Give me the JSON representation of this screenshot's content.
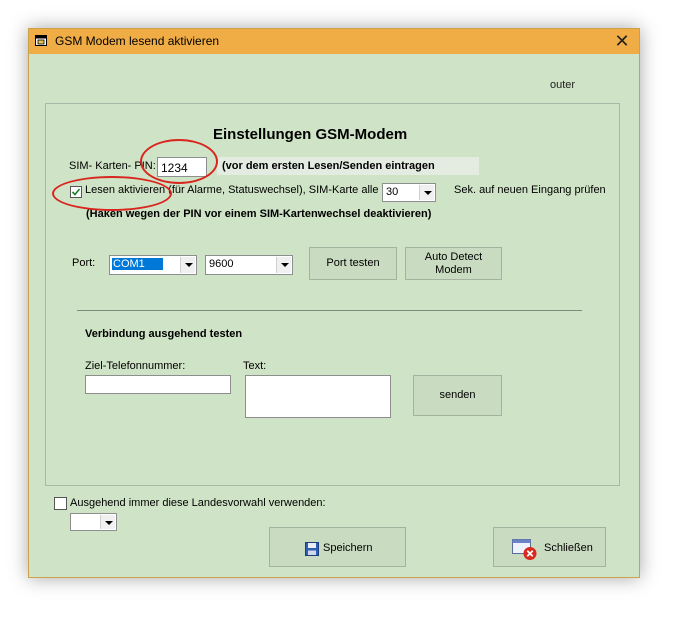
{
  "window": {
    "title": "GSM Modem lesend aktivieren",
    "icon": "app-window-icon",
    "close_symbol": "✕"
  },
  "router_label": "outer",
  "settings": {
    "heading": "Einstellungen GSM-Modem",
    "sim_pin_label": "SIM- Karten- PIN:",
    "sim_pin_value": "1234",
    "sim_pin_hint": "(vor dem ersten Lesen/Senden eintragen",
    "read_checkbox_checked": true,
    "read_checkbox_label": "Lesen aktivieren (für Alarme, Statuswechsel), SIM-Karte alle",
    "interval_value": "30",
    "interval_suffix": "Sek. auf neuen Eingang prüfen",
    "pin_warning": "(Haken wegen der PIN vor einem SIM-Kartenwechsel deaktivieren)",
    "port_label": "Port:",
    "port_value": "COM1",
    "baud_value": "9600",
    "port_test_button": "Port testen",
    "auto_detect_button": "Auto Detect\nModem"
  },
  "outgoing": {
    "heading": "Verbindung ausgehend testen",
    "phone_label": "Ziel-Telefonnummer:",
    "phone_value": "",
    "text_label": "Text:",
    "text_value": "",
    "send_button": "senden"
  },
  "country_code": {
    "checkbox_checked": false,
    "label": "Ausgehend immer diese Landesvorwahl verwenden:",
    "value": ""
  },
  "footer": {
    "save_button": "Speichern",
    "close_button": "Schließen"
  },
  "colors": {
    "titlebar": "#f1ad45",
    "window_bg": "#cfe3c6",
    "annotation_red": "#d8261f",
    "combo_selection": "#0078d7"
  }
}
